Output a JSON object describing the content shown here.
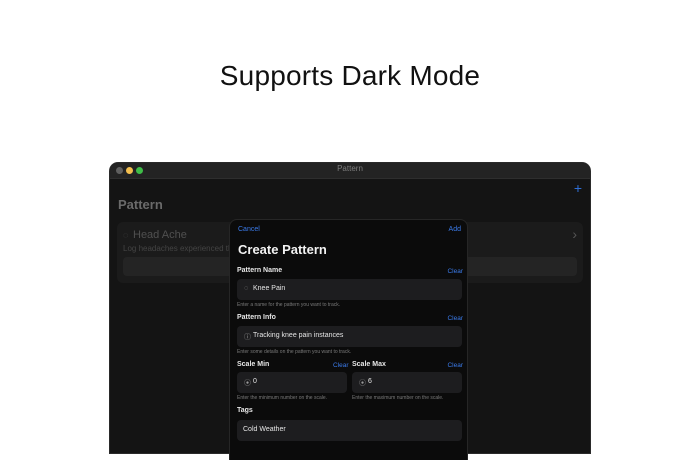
{
  "headline": "Supports Dark Mode",
  "window": {
    "title": "Pattern",
    "add_icon": "+",
    "list_title": "Pattern",
    "row": {
      "icon": "◌",
      "name": "Head Ache",
      "description": "Log headaches experienced through",
      "chevron": "›"
    }
  },
  "sheet": {
    "cancel": "Cancel",
    "add": "Add",
    "title": "Create Pattern",
    "pattern_name": {
      "label": "Pattern Name",
      "clear": "Clear",
      "icon": "◌",
      "value": "Knee Pain",
      "hint": "Enter a name for the pattern you want to track."
    },
    "pattern_info": {
      "label": "Pattern Info",
      "clear": "Clear",
      "icon": "ⓘ",
      "value": "Tracking knee pain instances",
      "hint": "Enter some details on the pattern you want to track."
    },
    "scale_min": {
      "label": "Scale Min",
      "clear": "Clear",
      "icon": "⦿",
      "value": "0",
      "hint": "Enter the minimum number on the scale."
    },
    "scale_max": {
      "label": "Scale Max",
      "clear": "Clear",
      "icon": "⦿",
      "value": "6",
      "hint": "Enter the maximum number on the scale."
    },
    "tags": {
      "label": "Tags",
      "value": "Cold Weather"
    }
  },
  "colors": {
    "accent": "#3b7bea",
    "window_bg": "#141414",
    "sheet_bg": "#0b0b0b",
    "field_bg": "#1d1d1f"
  }
}
